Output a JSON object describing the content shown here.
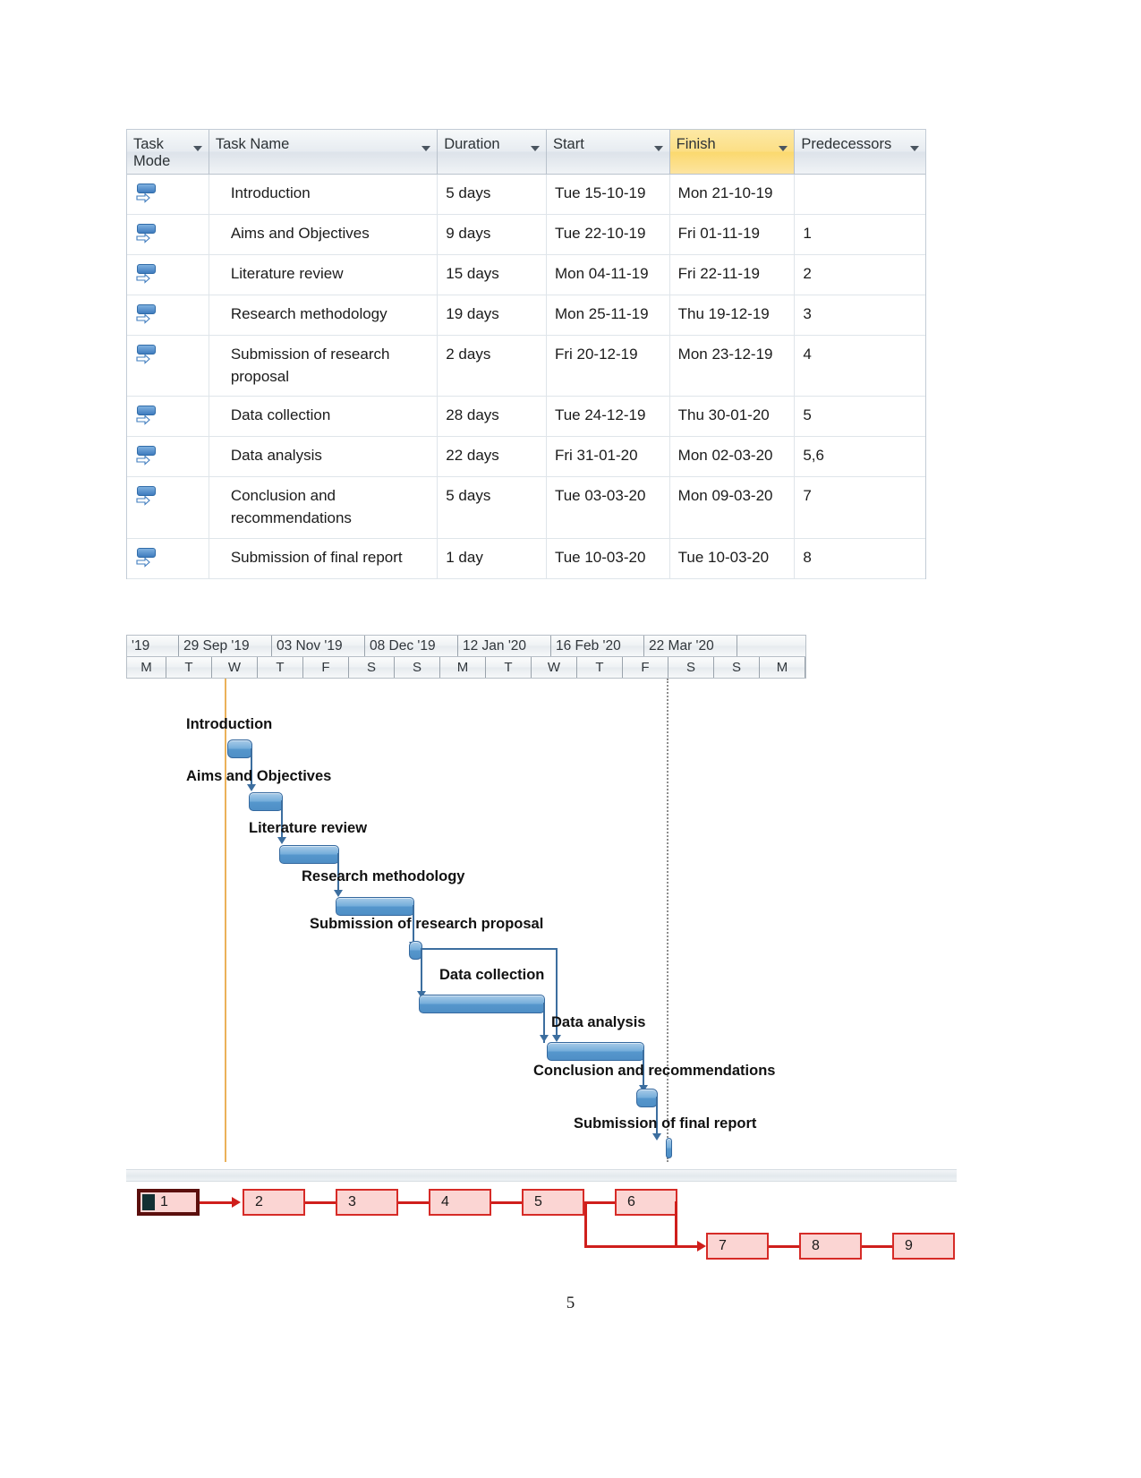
{
  "table": {
    "columns": [
      {
        "key": "mode",
        "label": "Task\nMode",
        "highlight": false
      },
      {
        "key": "name",
        "label": "Task Name",
        "highlight": false
      },
      {
        "key": "duration",
        "label": "Duration",
        "highlight": false
      },
      {
        "key": "start",
        "label": "Start",
        "highlight": false
      },
      {
        "key": "finish",
        "label": "Finish",
        "highlight": true
      },
      {
        "key": "predecessors",
        "label": "Predecessors",
        "highlight": false
      }
    ],
    "column_labels": {
      "task_mode_line1": "Task",
      "task_mode_line2": "Mode",
      "task_name": "Task Name",
      "duration": "Duration",
      "start": "Start",
      "finish": "Finish",
      "predecessors": "Predecessors"
    },
    "rows": [
      {
        "id": 1,
        "name": "Introduction",
        "duration": "5 days",
        "start": "Tue 15-10-19",
        "finish": "Mon 21-10-19",
        "predecessors": ""
      },
      {
        "id": 2,
        "name": "Aims and Objectives",
        "duration": "9 days",
        "start": "Tue 22-10-19",
        "finish": "Fri 01-11-19",
        "predecessors": "1"
      },
      {
        "id": 3,
        "name": "Literature review",
        "duration": "15 days",
        "start": "Mon 04-11-19",
        "finish": "Fri 22-11-19",
        "predecessors": "2"
      },
      {
        "id": 4,
        "name": "Research methodology",
        "duration": "19 days",
        "start": "Mon 25-11-19",
        "finish": "Thu 19-12-19",
        "predecessors": "3"
      },
      {
        "id": 5,
        "name": "Submission of research proposal",
        "duration": "2 days",
        "start": "Fri 20-12-19",
        "finish": "Mon 23-12-19",
        "predecessors": "4"
      },
      {
        "id": 6,
        "name": "Data collection",
        "duration": "28 days",
        "start": "Tue 24-12-19",
        "finish": "Thu 30-01-20",
        "predecessors": "5"
      },
      {
        "id": 7,
        "name": "Data analysis",
        "duration": "22 days",
        "start": "Fri 31-01-20",
        "finish": "Mon 02-03-20",
        "predecessors": "5,6"
      },
      {
        "id": 8,
        "name": "Conclusion and recommendations",
        "duration": "5 days",
        "start": "Tue 03-03-20",
        "finish": "Mon 09-03-20",
        "predecessors": "7"
      },
      {
        "id": 9,
        "name": "Submission of final report",
        "duration": "1 day",
        "start": "Tue 10-03-20",
        "finish": "Tue 10-03-20",
        "predecessors": "8"
      }
    ]
  },
  "gantt": {
    "timescale_major": [
      "'19",
      "29 Sep '19",
      "03 Nov '19",
      "08 Dec '19",
      "12 Jan '20",
      "16 Feb '20",
      "22 Mar '20"
    ],
    "timescale_minor": [
      "M",
      "T",
      "W",
      "T",
      "F",
      "S",
      "S",
      "M",
      "T",
      "W",
      "T",
      "F",
      "S",
      "S",
      "M"
    ],
    "bars": [
      {
        "label": "Introduction",
        "duration_days": 5
      },
      {
        "label": "Aims and Objectives",
        "duration_days": 9
      },
      {
        "label": "Literature review",
        "duration_days": 15
      },
      {
        "label": "Research methodology",
        "duration_days": 19
      },
      {
        "label": "Submission of research proposal",
        "duration_days": 2
      },
      {
        "label": "Data collection",
        "duration_days": 28
      },
      {
        "label": "Data analysis",
        "duration_days": 22
      },
      {
        "label": "Conclusion and recommendations",
        "duration_days": 5
      },
      {
        "label": "Submission of final report",
        "duration_days": 1
      }
    ]
  },
  "network": {
    "nodes": [
      "1",
      "2",
      "3",
      "4",
      "5",
      "6",
      "7",
      "8",
      "9"
    ]
  },
  "page": {
    "number": "5"
  },
  "colors": {
    "header_highlight": "#fbd96f",
    "bar_fill": "#5596cc",
    "bar_border": "#35699f",
    "link_line": "#3c6e9f",
    "network_node_fill": "#fbd5d3",
    "network_node_border": "#d62b27",
    "network_edge": "#cf1f1c",
    "today_line": "#e8a33d"
  }
}
